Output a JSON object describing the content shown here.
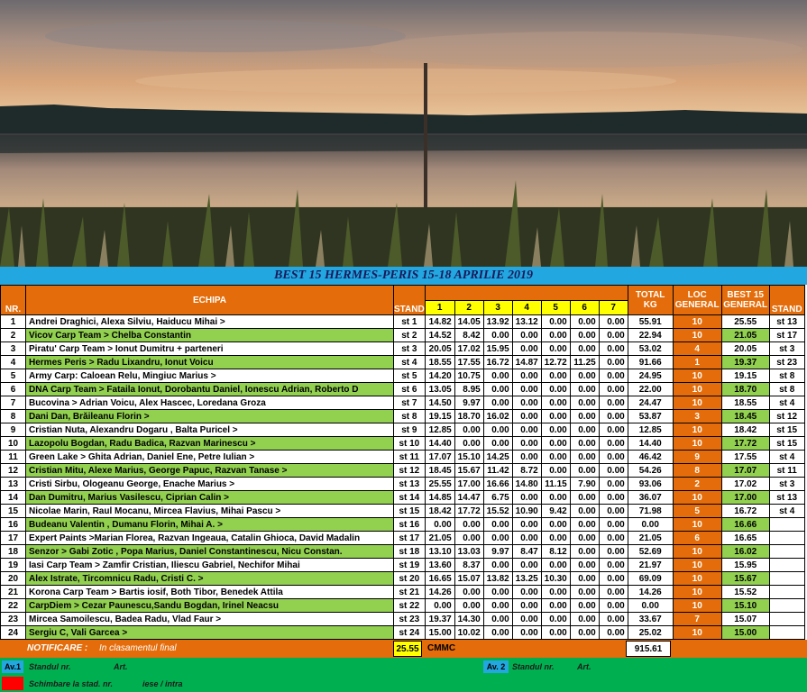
{
  "title": "BEST 15 HERMES-PERIS 15-18 APRILIE 2019",
  "headers": {
    "nr": "NR.",
    "echipa": "ECHIPA",
    "stand": "STAND",
    "rounds": [
      "1",
      "2",
      "3",
      "4",
      "5",
      "6",
      "7"
    ],
    "total_kg": [
      "TOTAL",
      "KG"
    ],
    "loc_general": [
      "LOC",
      "GENERAL"
    ],
    "best15_general": [
      "BEST 15",
      "GENERAL"
    ],
    "stand2": "STAND"
  },
  "rows": [
    {
      "nr": "1",
      "echipa": "Andrei Draghici, Alexa Silviu, Haiducu Mihai  >",
      "stand": "st 1",
      "r": [
        "14.82",
        "14.05",
        "13.92",
        "13.12",
        "0.00",
        "0.00",
        "0.00"
      ],
      "total": "55.91",
      "loc": "10",
      "best": "25.55",
      "stand2": "st 13",
      "y": []
    },
    {
      "nr": "2",
      "echipa": "Vicov Carp Team > Chelba Constantin",
      "stand": "st 2",
      "r": [
        "14.52",
        "8.42",
        "0.00",
        "0.00",
        "0.00",
        "0.00",
        "0.00"
      ],
      "total": "22.94",
      "loc": "10",
      "best": "21.05",
      "stand2": "st 17",
      "y": []
    },
    {
      "nr": "3",
      "echipa": "Piratu' Carp Team  > Ionut Dumitru + parteneri",
      "stand": "st 3",
      "r": [
        "20.05",
        "17.02",
        "15.95",
        "0.00",
        "0.00",
        "0.00",
        "0.00"
      ],
      "total": "53.02",
      "loc": "4",
      "best": "20.05",
      "stand2": "st 3",
      "y": [
        0,
        1
      ]
    },
    {
      "nr": "4",
      "echipa": "Hermes Peris > Radu Lixandru, Ionut Voicu",
      "stand": "st 4",
      "r": [
        "18.55",
        "17.55",
        "16.72",
        "14.87",
        "12.72",
        "11.25",
        "0.00"
      ],
      "total": "91.66",
      "loc": "1",
      "best": "19.37",
      "stand2": "st 23",
      "y": [
        0,
        1,
        2
      ]
    },
    {
      "nr": "5",
      "echipa": "Army Carp: Caloean Relu, Mingiuc Marius >",
      "stand": "st 5",
      "r": [
        "14.20",
        "10.75",
        "0.00",
        "0.00",
        "0.00",
        "0.00",
        "0.00"
      ],
      "total": "24.95",
      "loc": "10",
      "best": "19.15",
      "stand2": "st 8",
      "y": []
    },
    {
      "nr": "6",
      "echipa": "DNA Carp Team > Fataila Ionut, Dorobantu Daniel, Ionescu Adrian, Roberto D",
      "stand": "st 6",
      "r": [
        "13.05",
        "8.95",
        "0.00",
        "0.00",
        "0.00",
        "0.00",
        "0.00"
      ],
      "total": "22.00",
      "loc": "10",
      "best": "18.70",
      "stand2": "st 8",
      "y": []
    },
    {
      "nr": "7",
      "echipa": "Bucovina  > Adrian Voicu, Alex Hascec, Loredana Groza",
      "stand": "st 7",
      "r": [
        "14.50",
        "9.97",
        "0.00",
        "0.00",
        "0.00",
        "0.00",
        "0.00"
      ],
      "total": "24.47",
      "loc": "10",
      "best": "18.55",
      "stand2": "st 4",
      "y": []
    },
    {
      "nr": "8",
      "echipa": "Dani Dan, Brăileanu Florin  >",
      "stand": "st 8",
      "r": [
        "19.15",
        "18.70",
        "16.02",
        "0.00",
        "0.00",
        "0.00",
        "0.00"
      ],
      "total": "53.87",
      "loc": "3",
      "best": "18.45",
      "stand2": "st 12",
      "y": [
        0,
        1
      ]
    },
    {
      "nr": "9",
      "echipa": "Cristian Nuta, Alexandru Dogaru , Balta Puricel  >",
      "stand": "st 9",
      "r": [
        "12.85",
        "0.00",
        "0.00",
        "0.00",
        "0.00",
        "0.00",
        "0.00"
      ],
      "total": "12.85",
      "loc": "10",
      "best": "18.42",
      "stand2": "st 15",
      "y": []
    },
    {
      "nr": "10",
      "echipa": "Lazopolu Bogdan, Radu Badica, Razvan Marinescu  >",
      "stand": "st 10",
      "r": [
        "14.40",
        "0.00",
        "0.00",
        "0.00",
        "0.00",
        "0.00",
        "0.00"
      ],
      "total": "14.40",
      "loc": "10",
      "best": "17.72",
      "stand2": "st 15",
      "y": []
    },
    {
      "nr": "11",
      "echipa": "Green Lake > Ghita Adrian, Daniel Ene, Petre Iulian  >",
      "stand": "st 11",
      "r": [
        "17.07",
        "15.10",
        "14.25",
        "0.00",
        "0.00",
        "0.00",
        "0.00"
      ],
      "total": "46.42",
      "loc": "9",
      "best": "17.55",
      "stand2": "st 4",
      "y": [
        0
      ]
    },
    {
      "nr": "12",
      "echipa": "Cristian Mitu, Alexe Marius, George Papuc, Razvan Tanase  >",
      "stand": "st 12",
      "r": [
        "18.45",
        "15.67",
        "11.42",
        "8.72",
        "0.00",
        "0.00",
        "0.00"
      ],
      "total": "54.26",
      "loc": "8",
      "best": "17.07",
      "stand2": "st 11",
      "y": [
        0
      ]
    },
    {
      "nr": "13",
      "echipa": "Cristi Sirbu, Ologeanu George, Enache Marius >",
      "stand": "st 13",
      "r": [
        "25.55",
        "17.00",
        "16.66",
        "14.80",
        "11.15",
        "7.90",
        "0.00"
      ],
      "total": "93.06",
      "loc": "2",
      "best": "17.02",
      "stand2": "st 3",
      "y": [
        0,
        1
      ]
    },
    {
      "nr": "14",
      "echipa": "Dan Dumitru, Marius Vasilescu, Ciprian Calin  >",
      "stand": "st 14",
      "r": [
        "14.85",
        "14.47",
        "6.75",
        "0.00",
        "0.00",
        "0.00",
        "0.00"
      ],
      "total": "36.07",
      "loc": "10",
      "best": "17.00",
      "stand2": "st 13",
      "y": []
    },
    {
      "nr": "15",
      "echipa": "Nicolae Marin, Raul Mocanu, Mircea Flavius, Mihai Pascu >",
      "stand": "st 15",
      "r": [
        "18.42",
        "17.72",
        "15.52",
        "10.90",
        "9.42",
        "0.00",
        "0.00"
      ],
      "total": "71.98",
      "loc": "5",
      "best": "16.72",
      "stand2": "st 4",
      "y": [
        0,
        1
      ]
    },
    {
      "nr": "16",
      "echipa": "Budeanu Valentin , Dumanu Florin, Mihai A.  >",
      "stand": "st 16",
      "r": [
        "0.00",
        "0.00",
        "0.00",
        "0.00",
        "0.00",
        "0.00",
        "0.00"
      ],
      "total": "0.00",
      "loc": "10",
      "best": "16.66",
      "stand2": "",
      "y": []
    },
    {
      "nr": "17",
      "echipa": "Expert Paints >Marian Florea, Razvan Ingeaua, Catalin Ghioca, David Madalin",
      "stand": "st 17",
      "r": [
        "21.05",
        "0.00",
        "0.00",
        "0.00",
        "0.00",
        "0.00",
        "0.00"
      ],
      "total": "21.05",
      "loc": "6",
      "best": "16.65",
      "stand2": "",
      "y": [
        0
      ]
    },
    {
      "nr": "18",
      "echipa": "Senzor  > Gabi Zotic , Popa Marius, Daniel Constantinescu, Nicu Constan.",
      "stand": "st 18",
      "r": [
        "13.10",
        "13.03",
        "9.97",
        "8.47",
        "8.12",
        "0.00",
        "0.00"
      ],
      "total": "52.69",
      "loc": "10",
      "best": "16.02",
      "stand2": "",
      "y": []
    },
    {
      "nr": "19",
      "echipa": "Iasi Carp Team > Zamfir Cristian, Iliescu Gabriel, Nechifor Mihai",
      "stand": "st 19",
      "r": [
        "13.60",
        "8.37",
        "0.00",
        "0.00",
        "0.00",
        "0.00",
        "0.00"
      ],
      "total": "21.97",
      "loc": "10",
      "best": "15.95",
      "stand2": "",
      "y": []
    },
    {
      "nr": "20",
      "echipa": "Alex Istrate, Tircomnicu Radu, Cristi C.  >",
      "stand": "st 20",
      "r": [
        "16.65",
        "15.07",
        "13.82",
        "13.25",
        "10.30",
        "0.00",
        "0.00"
      ],
      "total": "69.09",
      "loc": "10",
      "best": "15.67",
      "stand2": "",
      "y": []
    },
    {
      "nr": "21",
      "echipa": "Korona Carp Team > Bartis iosif, Both Tibor, Benedek Attila",
      "stand": "st 21",
      "r": [
        "14.26",
        "0.00",
        "0.00",
        "0.00",
        "0.00",
        "0.00",
        "0.00"
      ],
      "total": "14.26",
      "loc": "10",
      "best": "15.52",
      "stand2": "",
      "y": []
    },
    {
      "nr": "22",
      "echipa": "CarpDiem > Cezar Paunescu,Sandu Bogdan, Irinel Neacsu",
      "stand": "st 22",
      "r": [
        "0.00",
        "0.00",
        "0.00",
        "0.00",
        "0.00",
        "0.00",
        "0.00"
      ],
      "total": "0.00",
      "loc": "10",
      "best": "15.10",
      "stand2": "",
      "y": []
    },
    {
      "nr": "23",
      "echipa": "Mircea Samoilescu, Badea Radu, Vlad Faur  >",
      "stand": "st 23",
      "r": [
        "19.37",
        "14.30",
        "0.00",
        "0.00",
        "0.00",
        "0.00",
        "0.00"
      ],
      "total": "33.67",
      "loc": "7",
      "best": "15.07",
      "stand2": "",
      "y": [
        0
      ]
    },
    {
      "nr": "24",
      "echipa": "Sergiu C, Vali Garcea  >",
      "stand": "st 24",
      "r": [
        "15.00",
        "10.02",
        "0.00",
        "0.00",
        "0.00",
        "0.00",
        "0.00"
      ],
      "total": "25.02",
      "loc": "10",
      "best": "15.00",
      "stand2": "",
      "y": []
    }
  ],
  "footer": {
    "notif_label": "NOTIFICARE :",
    "notif_text": "In clasamentul final",
    "notif_value": "25.55",
    "notif_cmmc": "CMMC",
    "grand_total": "915.61",
    "av1": "Av.1",
    "av1_standul": "Standul nr.",
    "av1_art": "Art.",
    "schimbare": "Schimbare la stad.  nr.",
    "iese": "iese / intra",
    "av2": "Av. 2",
    "av2_standul": "Standul  nr.",
    "av2_art": "Art."
  }
}
